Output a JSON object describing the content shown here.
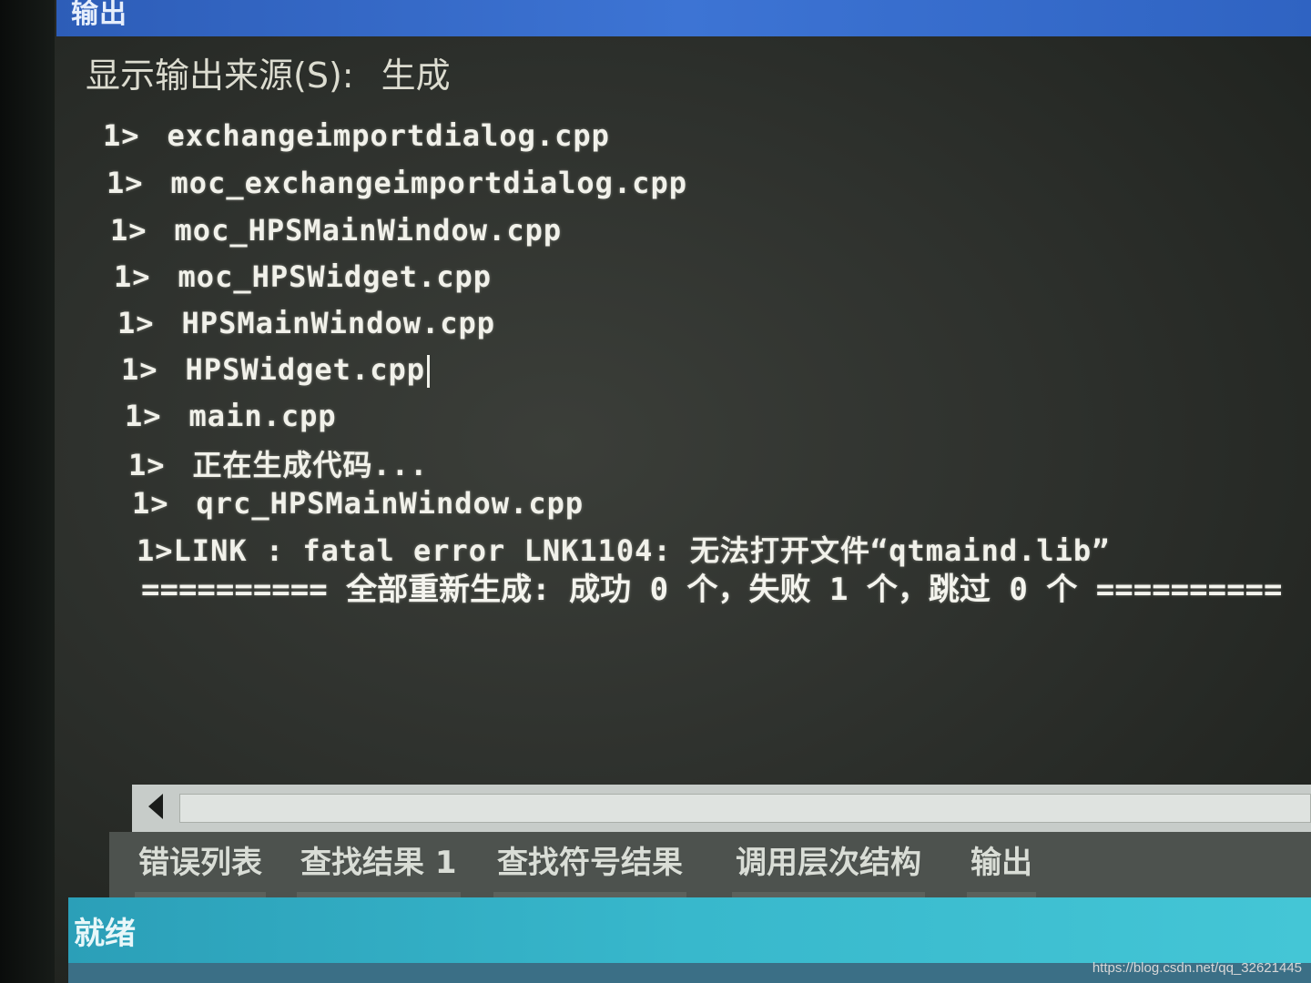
{
  "panel": {
    "title": "输出",
    "source_label": "显示输出来源(S):",
    "source_value": "生成"
  },
  "output": {
    "lines": [
      {
        "prefix": "1>",
        "text": "exchangeimportdialog.cpp"
      },
      {
        "prefix": "1>",
        "text": "moc_exchangeimportdialog.cpp"
      },
      {
        "prefix": "1>",
        "text": "moc_HPSMainWindow.cpp"
      },
      {
        "prefix": "1>",
        "text": "moc_HPSWidget.cpp"
      },
      {
        "prefix": "1>",
        "text": "HPSMainWindow.cpp"
      },
      {
        "prefix": "1>",
        "text": "HPSWidget.cpp"
      },
      {
        "prefix": "1>",
        "text": "main.cpp"
      },
      {
        "prefix": "1>",
        "text": "正在生成代码..."
      },
      {
        "prefix": "1>",
        "text": "qrc_HPSMainWindow.cpp"
      }
    ],
    "error_line": "1>LINK : fatal error LNK1104: 无法打开文件“qtmaind.lib”",
    "summary_line": "========== 全部重新生成: 成功 0 个，失败 1 个，跳过 0 个 =========="
  },
  "tabs": [
    {
      "label": "错误列表"
    },
    {
      "label": "查找结果 1"
    },
    {
      "label": "查找符号结果"
    },
    {
      "label": "调用层次结构"
    },
    {
      "label": "输出"
    }
  ],
  "status": {
    "text": "就绪"
  },
  "watermark": "https://blog.csdn.net/qq_32621445",
  "colors": {
    "console_bg": "#2e312d",
    "console_text": "#f1f1ea",
    "status_bar": "#38b8cc",
    "title_bar": "#3d74d4"
  }
}
